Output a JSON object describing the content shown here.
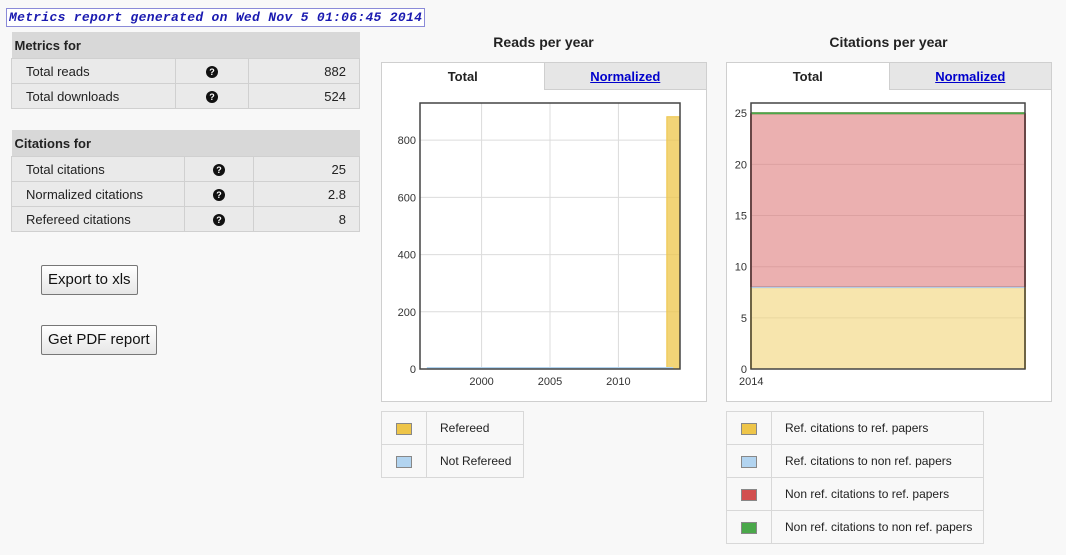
{
  "header": {
    "title": "Metrics report generated on Wed Nov 5 01:06:45 2014"
  },
  "reads_table": {
    "heading": "Metrics for",
    "rows": [
      {
        "label": "Total reads",
        "value": "882"
      },
      {
        "label": "Total downloads",
        "value": "524"
      }
    ]
  },
  "citations_table": {
    "heading": "Citations for",
    "rows": [
      {
        "label": "Total citations",
        "value": "25"
      },
      {
        "label": "Normalized citations",
        "value": "2.8"
      },
      {
        "label": "Refereed citations",
        "value": "8"
      }
    ]
  },
  "help_glyph": "?",
  "buttons": {
    "export": "Export to xls",
    "pdf": "Get PDF report"
  },
  "reads_chart": {
    "title": "Reads per year",
    "tabs": {
      "total": "Total",
      "normalized": "Normalized"
    },
    "legend": [
      {
        "label": "Refereed",
        "color": "#eec549"
      },
      {
        "label": "Not Refereed",
        "color": "#b2d4f0"
      }
    ]
  },
  "citations_chart": {
    "title": "Citations per year",
    "tabs": {
      "total": "Total",
      "normalized": "Normalized"
    },
    "legend": [
      {
        "label": "Ref. citations to ref. papers",
        "color": "#eec549"
      },
      {
        "label": "Ref. citations to non ref. papers",
        "color": "#b2d4f0"
      },
      {
        "label": "Non ref. citations to ref. papers",
        "color": "#d24f4f"
      },
      {
        "label": "Non ref. citations to non ref. papers",
        "color": "#4aa84a"
      }
    ]
  },
  "chart_data": [
    {
      "type": "bar",
      "x": [
        1996,
        1997,
        1998,
        1999,
        2000,
        2001,
        2002,
        2003,
        2004,
        2005,
        2006,
        2007,
        2008,
        2009,
        2010,
        2011,
        2012,
        2013,
        2014
      ],
      "xticks": [
        2000,
        2005,
        2010
      ],
      "yticks": [
        0,
        200,
        400,
        600,
        800
      ],
      "ylim": [
        0,
        930
      ],
      "series": [
        {
          "name": "Refereed",
          "color": "#eec549",
          "values": [
            0,
            0,
            0,
            0,
            0,
            0,
            0,
            0,
            0,
            0,
            0,
            0,
            0,
            0,
            0,
            0,
            0,
            0,
            882
          ]
        },
        {
          "name": "Not Refereed",
          "color": "#b2d4f0",
          "values": [
            0,
            0,
            0,
            0,
            0,
            0,
            0,
            0,
            0,
            0,
            0,
            0,
            0,
            0,
            0,
            0,
            0,
            0,
            0
          ]
        }
      ]
    },
    {
      "type": "area",
      "x": [
        2014
      ],
      "xticks": [
        2014
      ],
      "yticks": [
        0,
        5,
        10,
        15,
        20,
        25
      ],
      "ylim": [
        0,
        26
      ],
      "stacked": true,
      "series": [
        {
          "name": "Ref. citations to ref. papers",
          "color": "#eec549",
          "values": [
            8
          ]
        },
        {
          "name": "Ref. citations to non ref. papers",
          "color": "#b2d4f0",
          "values": [
            0
          ]
        },
        {
          "name": "Non ref. citations to ref. papers",
          "color": "#d24f4f",
          "values": [
            17
          ]
        },
        {
          "name": "Non ref. citations to non ref. papers",
          "color": "#4aa84a",
          "values": [
            0
          ]
        }
      ]
    }
  ]
}
